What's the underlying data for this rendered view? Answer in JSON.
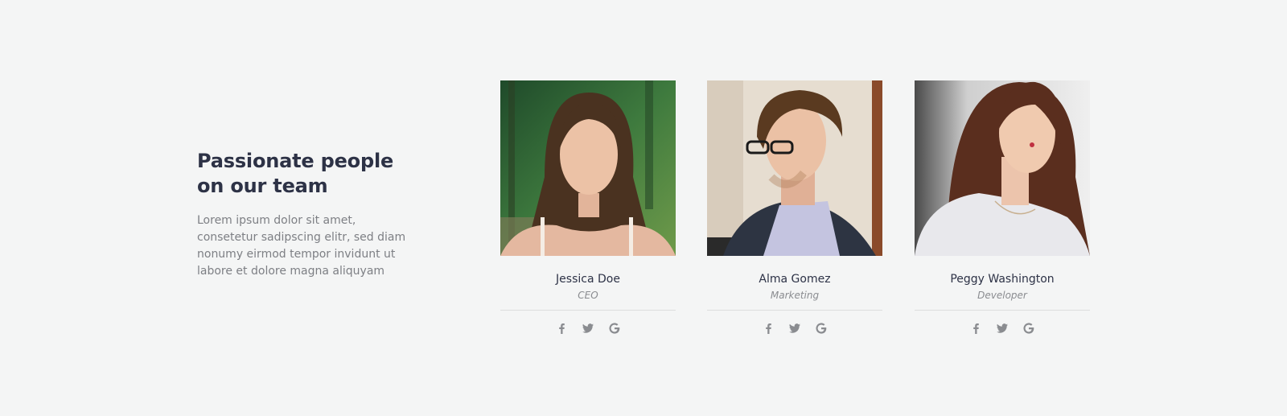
{
  "intro": {
    "title": "Passionate people on our team",
    "text": "Lorem ipsum dolor sit amet, consetetur sadipscing elitr, sed diam nonumy eirmod tempor invidunt ut labore et dolore magna aliquyam"
  },
  "members": [
    {
      "name": "Jessica Doe",
      "role": "CEO",
      "photo_icon": "photo-woman-forest"
    },
    {
      "name": "Alma Gomez",
      "role": "Marketing",
      "photo_icon": "photo-man-glasses"
    },
    {
      "name": "Peggy Washington",
      "role": "Developer",
      "photo_icon": "photo-woman-portrait"
    }
  ],
  "social_icons": [
    "facebook-icon",
    "twitter-icon",
    "google-icon"
  ],
  "colors": {
    "background": "#f4f5f5",
    "heading": "#2d3246",
    "body_text": "#7d7f84",
    "icon": "#8a8c90",
    "divider": "#dcdede"
  }
}
